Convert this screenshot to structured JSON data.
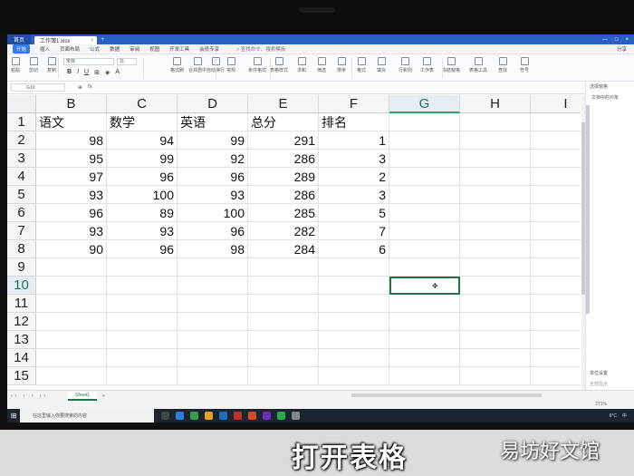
{
  "app": {
    "home_label": "首页",
    "file_tab": "工作簿1.xlsx",
    "menus": [
      "开始",
      "插入",
      "页面布局",
      "公式",
      "数据",
      "审阅",
      "视图",
      "开发工具",
      "会员专享"
    ],
    "search_placeholder": "查找命令、搜索模板",
    "share": "分享"
  },
  "ribbon": {
    "font_name": "宋体",
    "font_size": "11",
    "buttons": [
      "粘贴",
      "剪切",
      "复制",
      "格式刷",
      "合并居中",
      "自动换行",
      "常规",
      "条件格式",
      "表格样式",
      "求和",
      "筛选",
      "排序",
      "格式",
      "填充",
      "行和列",
      "工作表",
      "冻结窗格",
      "表格工具",
      "查找",
      "符号"
    ]
  },
  "formula": {
    "name_box": "G10"
  },
  "grid": {
    "columns": [
      "B",
      "C",
      "D",
      "E",
      "F",
      "G",
      "H",
      "I"
    ],
    "selected_column": "G",
    "rows": [
      "1",
      "2",
      "3",
      "4",
      "5",
      "6",
      "7",
      "8",
      "9",
      "10",
      "11",
      "12",
      "13",
      "14",
      "15"
    ],
    "selected_row": "10",
    "header": [
      "语文",
      "数学",
      "英语",
      "总分",
      "排名"
    ],
    "data": [
      [
        "98",
        "94",
        "99",
        "291",
        "1"
      ],
      [
        "95",
        "99",
        "92",
        "286",
        "3"
      ],
      [
        "97",
        "96",
        "96",
        "289",
        "2"
      ],
      [
        "93",
        "100",
        "93",
        "286",
        "3"
      ],
      [
        "96",
        "89",
        "100",
        "285",
        "5"
      ],
      [
        "93",
        "93",
        "96",
        "282",
        "7"
      ],
      [
        "90",
        "96",
        "98",
        "284",
        "6"
      ]
    ]
  },
  "right_panel": {
    "title": "选择窗格",
    "subtitle": "文档中的对象",
    "footer1": "单位设置",
    "footer2": "全部显示"
  },
  "sheet": {
    "tab": "Sheet1",
    "zoom": "271%"
  },
  "taskbar": {
    "search": "在这里输入你要搜索的内容",
    "temp": "6°C",
    "input_lang": "中",
    "time": ""
  },
  "caption": {
    "main": "打开表格",
    "brand": "易坊好文馆"
  },
  "colors": {
    "accent": "#217346",
    "titlebar": "#2b5fbd"
  }
}
